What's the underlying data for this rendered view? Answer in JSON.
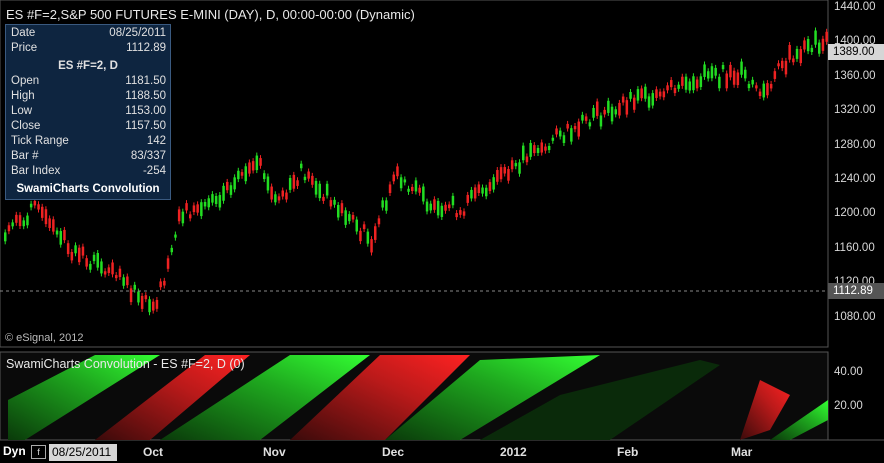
{
  "chart": {
    "title": "ES #F=2,S&P 500 FUTURES E-MINI (DAY), D, 00:00-00:00 (Dynamic)",
    "copyright": "© eSignal, 2012",
    "y_axis_labels": [
      "1440.00",
      "1400.00",
      "1360.00",
      "1320.00",
      "1280.00",
      "1240.00",
      "1200.00",
      "1160.00",
      "1120.00",
      "1080.00"
    ],
    "y_axis_values": [
      1440,
      1400,
      1360,
      1320,
      1280,
      1240,
      1200,
      1160,
      1120,
      1080
    ],
    "last_price_label": "1389.00",
    "crosshair_price_label": "1112.89",
    "colors": {
      "up": "#22dd22",
      "down": "#ee2222",
      "background": "#000000"
    }
  },
  "info": {
    "date_label": "Date",
    "date_value": "08/25/2011",
    "price_label": "Price",
    "price_value": "1112.89",
    "symbol": "ES #F=2, D",
    "open_label": "Open",
    "open_value": "1181.50",
    "high_label": "High",
    "high_value": "1188.50",
    "low_label": "Low",
    "low_value": "1153.00",
    "close_label": "Close",
    "close_value": "1157.50",
    "tick_label": "Tick Range",
    "tick_value": "142",
    "bar_label": "Bar #",
    "bar_value": "83/337",
    "index_label": "Bar Index",
    "index_value": "-254",
    "study": "SwamiCharts Convolution"
  },
  "indicator": {
    "title": "SwamiCharts Convolution - ES #F=2, D (0)",
    "y_axis_labels": [
      "40.00",
      "20.00"
    ]
  },
  "x_axis": {
    "dyn_label": "Dyn",
    "f_button": "f",
    "date_box": "08/25/2011",
    "labels": [
      "Oct",
      "Nov",
      "Dec",
      "2012",
      "Feb",
      "Mar"
    ]
  }
}
